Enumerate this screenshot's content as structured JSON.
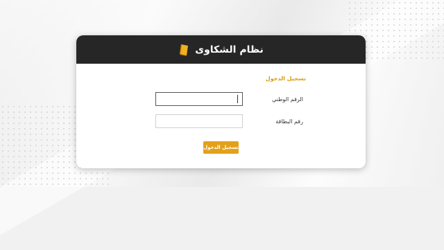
{
  "header": {
    "title": "نظام الشكاوى",
    "icon": "book-icon"
  },
  "form": {
    "section_title": "تسجيل الدخول",
    "national_id_label": "الرقم الوطني",
    "national_id_value": "",
    "card_number_label": "رقم البطاقة",
    "card_number_value": "",
    "submit_label": "تسجيل الدخول"
  },
  "colors": {
    "accent": "#e3a019",
    "header_bg": "#262626",
    "section_title": "#d99a12"
  }
}
